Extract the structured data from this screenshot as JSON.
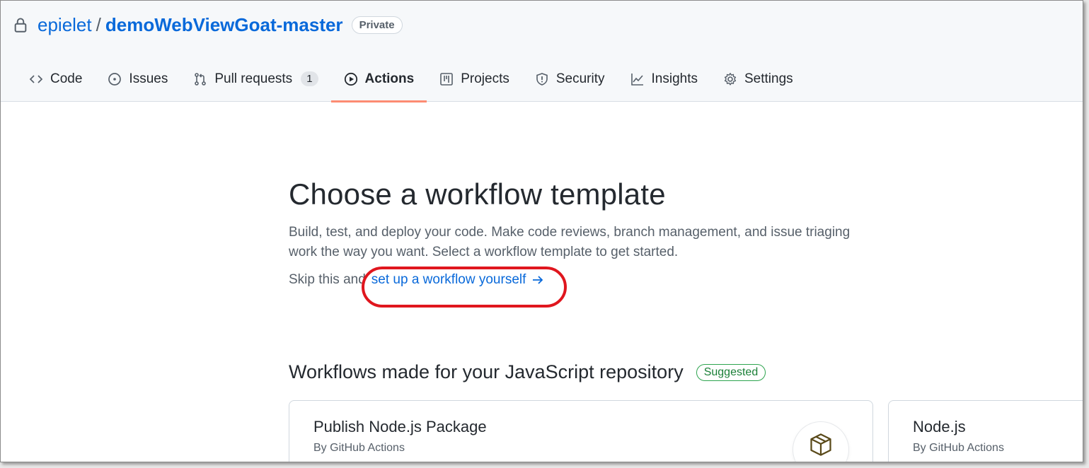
{
  "repo": {
    "owner": "epielet",
    "separator": "/",
    "name": "demoWebViewGoat-master",
    "visibility": "Private"
  },
  "tabs": [
    {
      "label": "Code",
      "icon": "code-icon"
    },
    {
      "label": "Issues",
      "icon": "issue-opened-icon"
    },
    {
      "label": "Pull requests",
      "icon": "git-pull-request-icon",
      "count": "1"
    },
    {
      "label": "Actions",
      "icon": "play-icon",
      "active": true
    },
    {
      "label": "Projects",
      "icon": "table-icon"
    },
    {
      "label": "Security",
      "icon": "shield-icon"
    },
    {
      "label": "Insights",
      "icon": "graph-icon"
    },
    {
      "label": "Settings",
      "icon": "gear-icon"
    }
  ],
  "main": {
    "title": "Choose a workflow template",
    "description": "Build, test, and deploy your code. Make code reviews, branch management, and issue triaging work the way you want. Select a workflow template to get started.",
    "skip_prefix": "Skip this and",
    "skip_link": "set up a workflow yourself"
  },
  "section": {
    "title": "Workflows made for your JavaScript repository",
    "badge": "Suggested"
  },
  "cards": [
    {
      "title": "Publish Node.js Package",
      "byline": "By GitHub Actions",
      "icon": "package-icon"
    },
    {
      "title": "Node.js",
      "byline": "By GitHub Actions"
    }
  ],
  "colors": {
    "link": "#0969da",
    "active_tab_underline": "#fd8c73",
    "highlight_ring": "#e0161e",
    "suggested_green": "#1a7f37"
  }
}
